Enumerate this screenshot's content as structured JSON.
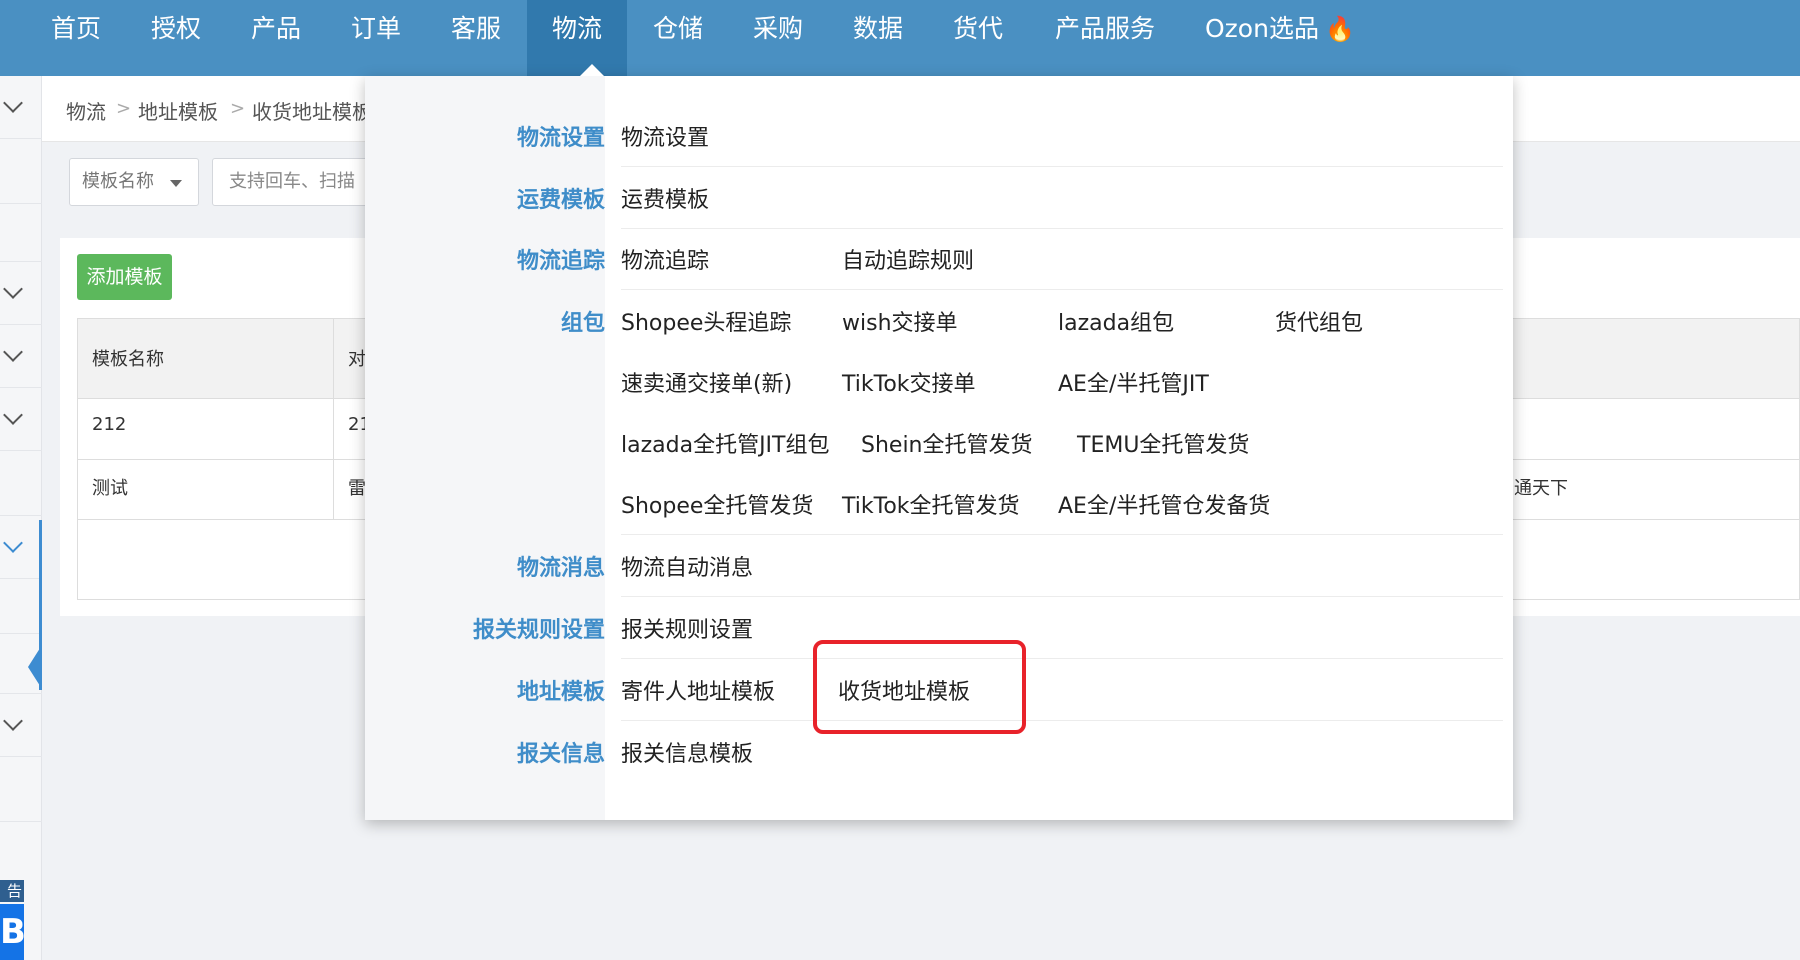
{
  "nav": {
    "items": [
      "首页",
      "授权",
      "产品",
      "订单",
      "客服",
      "物流",
      "仓储",
      "采购",
      "数据",
      "货代",
      "产品服务",
      "Ozon选品"
    ],
    "active": "物流",
    "fire_icon": "fire-icon"
  },
  "breadcrumb": [
    "物流",
    "地址模板",
    "收货地址模板"
  ],
  "filter": {
    "select_label": "模板名称",
    "input_placeholder": "支持回车、扫描"
  },
  "add_button": "添加模板",
  "table": {
    "headers": [
      "模板名称",
      "对"
    ],
    "rows": [
      {
        "name": "212",
        "col2": "21"
      },
      {
        "name": "测试",
        "col2": "雷",
        "extra": "富通天下"
      }
    ]
  },
  "dropdown": {
    "categories": [
      "物流设置",
      "运费模板",
      "物流追踪",
      "组包",
      "物流消息",
      "报关规则设置",
      "地址模板",
      "报关信息"
    ],
    "rows": {
      "logistics_settings": [
        "物流设置"
      ],
      "freight_template": [
        "运费模板"
      ],
      "tracking": [
        "物流追踪",
        "自动追踪规则"
      ],
      "package_1": [
        "Shopee头程追踪",
        "wish交接单",
        "lazada组包",
        "货代组包"
      ],
      "package_2": [
        "速卖通交接单(新)",
        "TikTok交接单",
        "AE全/半托管JIT"
      ],
      "package_3": [
        "lazada全托管JIT组包",
        "Shein全托管发货",
        "TEMU全托管发货"
      ],
      "package_4": [
        "Shopee全托管发货",
        "TikTok全托管发货",
        "AE全/半托管仓发备货"
      ],
      "messages": [
        "物流自动消息"
      ],
      "customs_rules": [
        "报关规则设置"
      ],
      "address": [
        "寄件人地址模板",
        "收货地址模板"
      ],
      "customs_info": [
        "报关信息模板"
      ]
    },
    "highlight_color": "#e8222a",
    "category_color": "#3f8dc9"
  },
  "sidebar": {
    "badge": "告✕",
    "logo": "B"
  }
}
